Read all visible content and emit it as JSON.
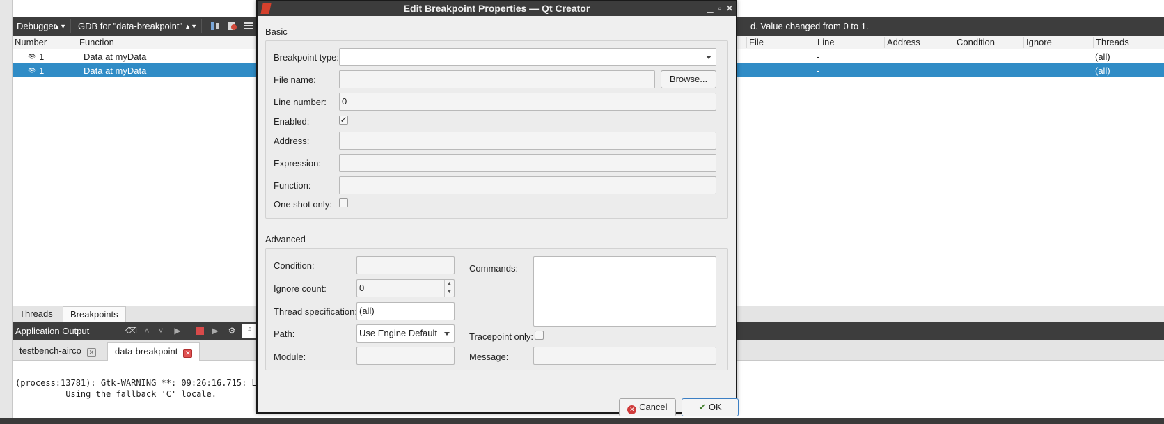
{
  "ide": {
    "toolbar": {
      "debugger_combo": "Debugger",
      "engine_combo": "GDB for \"data-breakpoint\"",
      "message": "d. Value changed from 0 to 1."
    },
    "breakpoints_table": {
      "columns": [
        "Number",
        "Function",
        "File",
        "Line",
        "Address",
        "Condition",
        "Ignore",
        "Threads"
      ],
      "rows": [
        {
          "number": "1",
          "function": "Data at myData",
          "line": "-",
          "threads": "(all)",
          "selected": false
        },
        {
          "number": "1",
          "function": "Data at myData",
          "line": "-",
          "threads": "(all)",
          "selected": true
        }
      ]
    },
    "debug_tabs": [
      "Threads",
      "Breakpoints"
    ],
    "application_output": {
      "title": "Application Output",
      "tabs": [
        "testbench-airco",
        "data-breakpoint"
      ],
      "lines": [
        "(process:13781): Gtk-WARNING **: 09:26:16.715: L",
        "          Using the fallback 'C' locale."
      ]
    }
  },
  "dialog": {
    "title": "Edit Breakpoint Properties — Qt Creator",
    "basic": {
      "group_title": "Basic",
      "breakpoint_type_label": "Breakpoint type:",
      "breakpoint_type_value": "",
      "file_name_label": "File name:",
      "file_name_value": "",
      "browse_button": "Browse...",
      "line_number_label": "Line number:",
      "line_number_value": "0",
      "enabled_label": "Enabled:",
      "enabled_checked": true,
      "address_label": "Address:",
      "address_value": "",
      "expression_label": "Expression:",
      "expression_value": "",
      "function_label": "Function:",
      "function_value": "",
      "one_shot_label": "One shot only:",
      "one_shot_checked": false
    },
    "advanced": {
      "group_title": "Advanced",
      "condition_label": "Condition:",
      "condition_value": "",
      "ignore_count_label": "Ignore count:",
      "ignore_count_value": "0",
      "thread_spec_label": "Thread specification:",
      "thread_spec_value": "(all)",
      "path_label": "Path:",
      "path_value": "Use Engine Default",
      "module_label": "Module:",
      "module_value": "",
      "commands_label": "Commands:",
      "tracepoint_label": "Tracepoint only:",
      "tracepoint_checked": false,
      "message_label": "Message:",
      "message_value": ""
    },
    "buttons": {
      "cancel": "Cancel",
      "ok": "OK"
    }
  },
  "colors": {
    "selection": "#308cc6",
    "dark_bar": "#3d3d3d",
    "title_bar": "#3c3c3c"
  }
}
